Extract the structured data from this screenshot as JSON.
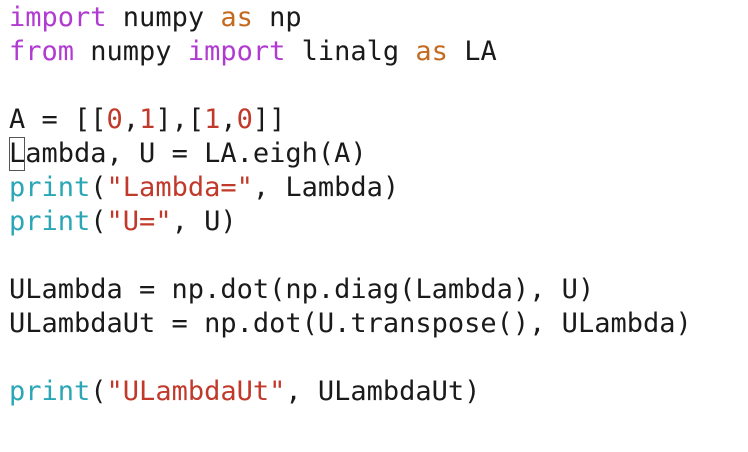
{
  "editor": {
    "lines": [
      [
        {
          "t": "import",
          "c": "kw"
        },
        {
          "t": " numpy ",
          "c": "plain"
        },
        {
          "t": "as",
          "c": "as"
        },
        {
          "t": " np",
          "c": "plain"
        }
      ],
      [
        {
          "t": "from",
          "c": "kw"
        },
        {
          "t": " numpy ",
          "c": "plain"
        },
        {
          "t": "import",
          "c": "kw"
        },
        {
          "t": " linalg ",
          "c": "plain"
        },
        {
          "t": "as",
          "c": "as"
        },
        {
          "t": " LA",
          "c": "plain"
        }
      ],
      [],
      [
        {
          "t": "A = [[",
          "c": "plain"
        },
        {
          "t": "0",
          "c": "num"
        },
        {
          "t": ",",
          "c": "plain"
        },
        {
          "t": "1",
          "c": "num"
        },
        {
          "t": "],[",
          "c": "plain"
        },
        {
          "t": "1",
          "c": "num"
        },
        {
          "t": ",",
          "c": "plain"
        },
        {
          "t": "0",
          "c": "num"
        },
        {
          "t": "]]",
          "c": "plain"
        }
      ],
      [
        {
          "t": "L",
          "c": "plain",
          "cursor": true
        },
        {
          "t": "ambda, U = LA.eigh(A)",
          "c": "plain"
        }
      ],
      [
        {
          "t": "print",
          "c": "fn"
        },
        {
          "t": "(",
          "c": "plain"
        },
        {
          "t": "\"Lambda=\"",
          "c": "str"
        },
        {
          "t": ", Lambda)",
          "c": "plain"
        }
      ],
      [
        {
          "t": "print",
          "c": "fn"
        },
        {
          "t": "(",
          "c": "plain"
        },
        {
          "t": "\"U=\"",
          "c": "str"
        },
        {
          "t": ", U)",
          "c": "plain"
        }
      ],
      [],
      [
        {
          "t": "ULambda = np.dot(np.diag(Lambda), U)",
          "c": "plain"
        }
      ],
      [
        {
          "t": "ULambdaUt = np.dot(U.transpose(), ULambda)",
          "c": "plain"
        }
      ],
      [],
      [
        {
          "t": "print",
          "c": "fn"
        },
        {
          "t": "(",
          "c": "plain"
        },
        {
          "t": "\"ULambdaUt\"",
          "c": "str"
        },
        {
          "t": ", ULambdaUt)",
          "c": "plain"
        }
      ]
    ]
  },
  "colors": {
    "keyword": "#b13bd1",
    "as_keyword": "#c46a1e",
    "number": "#c0392b",
    "string": "#c0392b",
    "builtin_function": "#2aa6b6",
    "plain_text": "#1a1a1a",
    "background": "#ffffff"
  }
}
